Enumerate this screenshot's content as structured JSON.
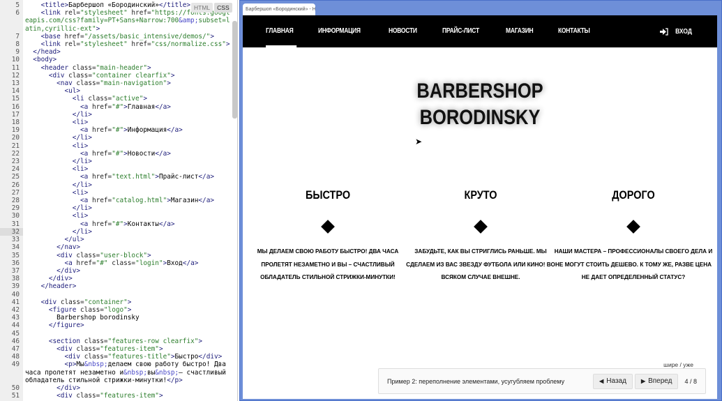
{
  "editor": {
    "modes": [
      "HTML",
      "CSS"
    ],
    "current_line": 32,
    "lines": [
      {
        "n": 5,
        "t": [
          [
            "text",
            "    "
          ],
          [
            "tag",
            "<title>"
          ],
          [
            "text",
            "Барбершоп «Бородинский»"
          ],
          [
            "tag",
            "</title>"
          ]
        ]
      },
      {
        "n": 6,
        "t": [
          [
            "text",
            "    "
          ],
          [
            "tag",
            "<link "
          ],
          [
            "attr",
            "rel="
          ],
          [
            "str",
            "\"stylesheet\""
          ],
          [
            "attr",
            " href="
          ],
          [
            "str",
            "\"https://fonts.googleapis.com/css?family=PT+Sans+Narrow:700"
          ],
          [
            "ent",
            "&amp;"
          ],
          [
            "str",
            "subset=latin,cyrillic-ext\""
          ],
          [
            "tag",
            ">"
          ]
        ]
      },
      {
        "n": 7,
        "t": [
          [
            "text",
            "    "
          ],
          [
            "tag",
            "<base "
          ],
          [
            "attr",
            "href="
          ],
          [
            "str",
            "\"/assets/basic_intensive/demos/\""
          ],
          [
            "tag",
            ">"
          ]
        ]
      },
      {
        "n": 8,
        "t": [
          [
            "text",
            "    "
          ],
          [
            "tag",
            "<link "
          ],
          [
            "attr",
            "rel="
          ],
          [
            "str",
            "\"stylesheet\""
          ],
          [
            "attr",
            " href="
          ],
          [
            "str",
            "\"css/normalize.css\""
          ],
          [
            "tag",
            ">"
          ]
        ]
      },
      {
        "n": 9,
        "t": [
          [
            "text",
            "  "
          ],
          [
            "tag",
            "</head>"
          ]
        ]
      },
      {
        "n": 10,
        "t": [
          [
            "text",
            "  "
          ],
          [
            "tag",
            "<body>"
          ]
        ]
      },
      {
        "n": 11,
        "t": [
          [
            "text",
            "    "
          ],
          [
            "tag",
            "<header "
          ],
          [
            "attr",
            "class="
          ],
          [
            "str",
            "\"main-header\""
          ],
          [
            "tag",
            ">"
          ]
        ]
      },
      {
        "n": 12,
        "t": [
          [
            "text",
            "      "
          ],
          [
            "tag",
            "<div "
          ],
          [
            "attr",
            "class="
          ],
          [
            "str",
            "\"container clearfix\""
          ],
          [
            "tag",
            ">"
          ]
        ]
      },
      {
        "n": 13,
        "t": [
          [
            "text",
            "        "
          ],
          [
            "tag",
            "<nav "
          ],
          [
            "attr",
            "class="
          ],
          [
            "str",
            "\"main-navigation\""
          ],
          [
            "tag",
            ">"
          ]
        ]
      },
      {
        "n": 14,
        "t": [
          [
            "text",
            "          "
          ],
          [
            "tag",
            "<ul>"
          ]
        ]
      },
      {
        "n": 15,
        "t": [
          [
            "text",
            "            "
          ],
          [
            "tag",
            "<li "
          ],
          [
            "attr",
            "class="
          ],
          [
            "str",
            "\"active\""
          ],
          [
            "tag",
            ">"
          ]
        ]
      },
      {
        "n": 16,
        "t": [
          [
            "text",
            "              "
          ],
          [
            "tag",
            "<a "
          ],
          [
            "attr",
            "href="
          ],
          [
            "str",
            "\"#\""
          ],
          [
            "tag",
            ">"
          ],
          [
            "text",
            "Главная"
          ],
          [
            "tag",
            "</a>"
          ]
        ]
      },
      {
        "n": 17,
        "t": [
          [
            "text",
            "            "
          ],
          [
            "tag",
            "</li>"
          ]
        ]
      },
      {
        "n": 18,
        "t": [
          [
            "text",
            "            "
          ],
          [
            "tag",
            "<li>"
          ]
        ]
      },
      {
        "n": 19,
        "t": [
          [
            "text",
            "              "
          ],
          [
            "tag",
            "<a "
          ],
          [
            "attr",
            "href="
          ],
          [
            "str",
            "\"#\""
          ],
          [
            "tag",
            ">"
          ],
          [
            "text",
            "Информация"
          ],
          [
            "tag",
            "</a>"
          ]
        ]
      },
      {
        "n": 20,
        "t": [
          [
            "text",
            "            "
          ],
          [
            "tag",
            "</li>"
          ]
        ]
      },
      {
        "n": 21,
        "t": [
          [
            "text",
            "            "
          ],
          [
            "tag",
            "<li>"
          ]
        ]
      },
      {
        "n": 22,
        "t": [
          [
            "text",
            "              "
          ],
          [
            "tag",
            "<a "
          ],
          [
            "attr",
            "href="
          ],
          [
            "str",
            "\"#\""
          ],
          [
            "tag",
            ">"
          ],
          [
            "text",
            "Новости"
          ],
          [
            "tag",
            "</a>"
          ]
        ]
      },
      {
        "n": 23,
        "t": [
          [
            "text",
            "            "
          ],
          [
            "tag",
            "</li>"
          ]
        ]
      },
      {
        "n": 24,
        "t": [
          [
            "text",
            "            "
          ],
          [
            "tag",
            "<li>"
          ]
        ]
      },
      {
        "n": 25,
        "t": [
          [
            "text",
            "              "
          ],
          [
            "tag",
            "<a "
          ],
          [
            "attr",
            "href="
          ],
          [
            "str",
            "\"text.html\""
          ],
          [
            "tag",
            ">"
          ],
          [
            "text",
            "Прайс-лист"
          ],
          [
            "tag",
            "</a>"
          ]
        ]
      },
      {
        "n": 26,
        "t": [
          [
            "text",
            "            "
          ],
          [
            "tag",
            "</li>"
          ]
        ]
      },
      {
        "n": 27,
        "t": [
          [
            "text",
            "            "
          ],
          [
            "tag",
            "<li>"
          ]
        ]
      },
      {
        "n": 28,
        "t": [
          [
            "text",
            "              "
          ],
          [
            "tag",
            "<a "
          ],
          [
            "attr",
            "href="
          ],
          [
            "str",
            "\"catalog.html\""
          ],
          [
            "tag",
            ">"
          ],
          [
            "text",
            "Магазин"
          ],
          [
            "tag",
            "</a>"
          ]
        ]
      },
      {
        "n": 29,
        "t": [
          [
            "text",
            "            "
          ],
          [
            "tag",
            "</li>"
          ]
        ]
      },
      {
        "n": 30,
        "t": [
          [
            "text",
            "            "
          ],
          [
            "tag",
            "<li>"
          ]
        ]
      },
      {
        "n": 31,
        "t": [
          [
            "text",
            "              "
          ],
          [
            "tag",
            "<a "
          ],
          [
            "attr",
            "href="
          ],
          [
            "str",
            "\"#\""
          ],
          [
            "tag",
            ">"
          ],
          [
            "text",
            "Контакты"
          ],
          [
            "tag",
            "</a>"
          ]
        ]
      },
      {
        "n": 32,
        "t": [
          [
            "text",
            "            "
          ],
          [
            "tag",
            "</li>"
          ]
        ]
      },
      {
        "n": 33,
        "t": [
          [
            "text",
            "          "
          ],
          [
            "tag",
            "</ul>"
          ]
        ]
      },
      {
        "n": 34,
        "t": [
          [
            "text",
            "        "
          ],
          [
            "tag",
            "</nav>"
          ]
        ]
      },
      {
        "n": 35,
        "t": [
          [
            "text",
            "        "
          ],
          [
            "tag",
            "<div "
          ],
          [
            "attr",
            "class="
          ],
          [
            "str",
            "\"user-block\""
          ],
          [
            "tag",
            ">"
          ]
        ]
      },
      {
        "n": 36,
        "t": [
          [
            "text",
            "          "
          ],
          [
            "tag",
            "<a "
          ],
          [
            "attr",
            "href="
          ],
          [
            "str",
            "\"#\""
          ],
          [
            "attr",
            " class="
          ],
          [
            "str",
            "\"login\""
          ],
          [
            "tag",
            ">"
          ],
          [
            "text",
            "Вход"
          ],
          [
            "tag",
            "</a>"
          ]
        ]
      },
      {
        "n": 37,
        "t": [
          [
            "text",
            "        "
          ],
          [
            "tag",
            "</div>"
          ]
        ]
      },
      {
        "n": 38,
        "t": [
          [
            "text",
            "      "
          ],
          [
            "tag",
            "</div>"
          ]
        ]
      },
      {
        "n": 39,
        "t": [
          [
            "text",
            "    "
          ],
          [
            "tag",
            "</header>"
          ]
        ]
      },
      {
        "n": 40,
        "t": [
          [
            "text",
            ""
          ]
        ]
      },
      {
        "n": 41,
        "t": [
          [
            "text",
            "    "
          ],
          [
            "tag",
            "<div "
          ],
          [
            "attr",
            "class="
          ],
          [
            "str",
            "\"container\""
          ],
          [
            "tag",
            ">"
          ]
        ]
      },
      {
        "n": 42,
        "t": [
          [
            "text",
            "      "
          ],
          [
            "tag",
            "<figure "
          ],
          [
            "attr",
            "class="
          ],
          [
            "str",
            "\"logo\""
          ],
          [
            "tag",
            ">"
          ]
        ]
      },
      {
        "n": 43,
        "t": [
          [
            "text",
            "        Barbershop borodinsky"
          ]
        ]
      },
      {
        "n": 44,
        "t": [
          [
            "text",
            "      "
          ],
          [
            "tag",
            "</figure>"
          ]
        ]
      },
      {
        "n": 45,
        "t": [
          [
            "text",
            ""
          ]
        ]
      },
      {
        "n": 46,
        "t": [
          [
            "text",
            "      "
          ],
          [
            "tag",
            "<section "
          ],
          [
            "attr",
            "class="
          ],
          [
            "str",
            "\"features-row clearfix\""
          ],
          [
            "tag",
            ">"
          ]
        ]
      },
      {
        "n": 47,
        "t": [
          [
            "text",
            "        "
          ],
          [
            "tag",
            "<div "
          ],
          [
            "attr",
            "class="
          ],
          [
            "str",
            "\"features-item\""
          ],
          [
            "tag",
            ">"
          ]
        ]
      },
      {
        "n": 48,
        "t": [
          [
            "text",
            "          "
          ],
          [
            "tag",
            "<div "
          ],
          [
            "attr",
            "class="
          ],
          [
            "str",
            "\"features-title\""
          ],
          [
            "tag",
            ">"
          ],
          [
            "text",
            "Быстро"
          ],
          [
            "tag",
            "</div>"
          ]
        ]
      },
      {
        "n": 49,
        "t": [
          [
            "text",
            "          "
          ],
          [
            "tag",
            "<p>"
          ],
          [
            "text",
            "Мы"
          ],
          [
            "ent",
            "&nbsp;"
          ],
          [
            "text",
            "делаем свою работу быстро! Два часа пролетят незаметно и"
          ],
          [
            "ent",
            "&nbsp;"
          ],
          [
            "text",
            "вы"
          ],
          [
            "ent",
            "&nbsp;"
          ],
          [
            "text",
            "– счастливый обладатель стильной стрижки-минутки!"
          ],
          [
            "tag",
            "</p>"
          ]
        ]
      },
      {
        "n": 50,
        "t": [
          [
            "text",
            "        "
          ],
          [
            "tag",
            "</div>"
          ]
        ]
      },
      {
        "n": 51,
        "t": [
          [
            "text",
            "        "
          ],
          [
            "tag",
            "<div "
          ],
          [
            "attr",
            "class="
          ],
          [
            "str",
            "\"features-item\""
          ],
          [
            "tag",
            ">"
          ]
        ]
      }
    ]
  },
  "preview": {
    "tab_title": "Барбершоп «Бородинский» - HTML",
    "nav": [
      "Главная",
      "Информация",
      "Новости",
      "Прайс-лист",
      "Магазин",
      "Контакты"
    ],
    "active_nav": 0,
    "login": "Вход",
    "login_icon": "sign-in-icon",
    "logo": [
      "BARBERSHOP",
      "BORODINSKY"
    ],
    "features": [
      {
        "title": "Быстро",
        "text": "Мы делаем свою работу быстро! Два часа пролетят незаметно и вы – счастливый обладатель стильной стрижки-минутки!"
      },
      {
        "title": "Круто",
        "text": "Забудьте, как вы стриглись раньше. Мы сделаем из вас звезду футбола или кино! Во всяком случае внешне."
      },
      {
        "title": "Дорого",
        "text": "Наши мастера – профессионалы своего дела и не могут стоить дешево. К тому же, разве цена не дает определенный статус?"
      }
    ]
  },
  "demo": {
    "width_toggle": "шире / уже",
    "caption": "Пример 2: переполнение элементами, усугубляем проблему",
    "back": "Назад",
    "forward": "Вперед",
    "counter": "4 / 8"
  },
  "colors": {
    "frame": "#6e8fd8",
    "nav_bg": "#000000"
  }
}
